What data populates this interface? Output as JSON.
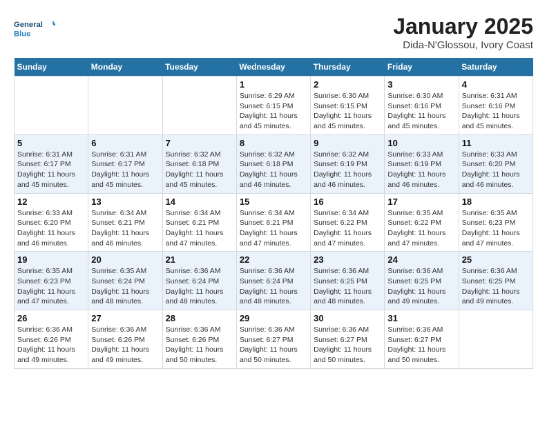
{
  "logo": {
    "line1": "General",
    "line2": "Blue"
  },
  "title": "January 2025",
  "subtitle": "Dida-N'Glossou, Ivory Coast",
  "days_of_week": [
    "Sunday",
    "Monday",
    "Tuesday",
    "Wednesday",
    "Thursday",
    "Friday",
    "Saturday"
  ],
  "weeks": [
    [
      {
        "day": "",
        "info": ""
      },
      {
        "day": "",
        "info": ""
      },
      {
        "day": "",
        "info": ""
      },
      {
        "day": "1",
        "info": "Sunrise: 6:29 AM\nSunset: 6:15 PM\nDaylight: 11 hours\nand 45 minutes."
      },
      {
        "day": "2",
        "info": "Sunrise: 6:30 AM\nSunset: 6:15 PM\nDaylight: 11 hours\nand 45 minutes."
      },
      {
        "day": "3",
        "info": "Sunrise: 6:30 AM\nSunset: 6:16 PM\nDaylight: 11 hours\nand 45 minutes."
      },
      {
        "day": "4",
        "info": "Sunrise: 6:31 AM\nSunset: 6:16 PM\nDaylight: 11 hours\nand 45 minutes."
      }
    ],
    [
      {
        "day": "5",
        "info": "Sunrise: 6:31 AM\nSunset: 6:17 PM\nDaylight: 11 hours\nand 45 minutes."
      },
      {
        "day": "6",
        "info": "Sunrise: 6:31 AM\nSunset: 6:17 PM\nDaylight: 11 hours\nand 45 minutes."
      },
      {
        "day": "7",
        "info": "Sunrise: 6:32 AM\nSunset: 6:18 PM\nDaylight: 11 hours\nand 45 minutes."
      },
      {
        "day": "8",
        "info": "Sunrise: 6:32 AM\nSunset: 6:18 PM\nDaylight: 11 hours\nand 46 minutes."
      },
      {
        "day": "9",
        "info": "Sunrise: 6:32 AM\nSunset: 6:19 PM\nDaylight: 11 hours\nand 46 minutes."
      },
      {
        "day": "10",
        "info": "Sunrise: 6:33 AM\nSunset: 6:19 PM\nDaylight: 11 hours\nand 46 minutes."
      },
      {
        "day": "11",
        "info": "Sunrise: 6:33 AM\nSunset: 6:20 PM\nDaylight: 11 hours\nand 46 minutes."
      }
    ],
    [
      {
        "day": "12",
        "info": "Sunrise: 6:33 AM\nSunset: 6:20 PM\nDaylight: 11 hours\nand 46 minutes."
      },
      {
        "day": "13",
        "info": "Sunrise: 6:34 AM\nSunset: 6:21 PM\nDaylight: 11 hours\nand 46 minutes."
      },
      {
        "day": "14",
        "info": "Sunrise: 6:34 AM\nSunset: 6:21 PM\nDaylight: 11 hours\nand 47 minutes."
      },
      {
        "day": "15",
        "info": "Sunrise: 6:34 AM\nSunset: 6:21 PM\nDaylight: 11 hours\nand 47 minutes."
      },
      {
        "day": "16",
        "info": "Sunrise: 6:34 AM\nSunset: 6:22 PM\nDaylight: 11 hours\nand 47 minutes."
      },
      {
        "day": "17",
        "info": "Sunrise: 6:35 AM\nSunset: 6:22 PM\nDaylight: 11 hours\nand 47 minutes."
      },
      {
        "day": "18",
        "info": "Sunrise: 6:35 AM\nSunset: 6:23 PM\nDaylight: 11 hours\nand 47 minutes."
      }
    ],
    [
      {
        "day": "19",
        "info": "Sunrise: 6:35 AM\nSunset: 6:23 PM\nDaylight: 11 hours\nand 47 minutes."
      },
      {
        "day": "20",
        "info": "Sunrise: 6:35 AM\nSunset: 6:24 PM\nDaylight: 11 hours\nand 48 minutes."
      },
      {
        "day": "21",
        "info": "Sunrise: 6:36 AM\nSunset: 6:24 PM\nDaylight: 11 hours\nand 48 minutes."
      },
      {
        "day": "22",
        "info": "Sunrise: 6:36 AM\nSunset: 6:24 PM\nDaylight: 11 hours\nand 48 minutes."
      },
      {
        "day": "23",
        "info": "Sunrise: 6:36 AM\nSunset: 6:25 PM\nDaylight: 11 hours\nand 48 minutes."
      },
      {
        "day": "24",
        "info": "Sunrise: 6:36 AM\nSunset: 6:25 PM\nDaylight: 11 hours\nand 49 minutes."
      },
      {
        "day": "25",
        "info": "Sunrise: 6:36 AM\nSunset: 6:25 PM\nDaylight: 11 hours\nand 49 minutes."
      }
    ],
    [
      {
        "day": "26",
        "info": "Sunrise: 6:36 AM\nSunset: 6:26 PM\nDaylight: 11 hours\nand 49 minutes."
      },
      {
        "day": "27",
        "info": "Sunrise: 6:36 AM\nSunset: 6:26 PM\nDaylight: 11 hours\nand 49 minutes."
      },
      {
        "day": "28",
        "info": "Sunrise: 6:36 AM\nSunset: 6:26 PM\nDaylight: 11 hours\nand 50 minutes."
      },
      {
        "day": "29",
        "info": "Sunrise: 6:36 AM\nSunset: 6:27 PM\nDaylight: 11 hours\nand 50 minutes."
      },
      {
        "day": "30",
        "info": "Sunrise: 6:36 AM\nSunset: 6:27 PM\nDaylight: 11 hours\nand 50 minutes."
      },
      {
        "day": "31",
        "info": "Sunrise: 6:36 AM\nSunset: 6:27 PM\nDaylight: 11 hours\nand 50 minutes."
      },
      {
        "day": "",
        "info": ""
      }
    ]
  ]
}
